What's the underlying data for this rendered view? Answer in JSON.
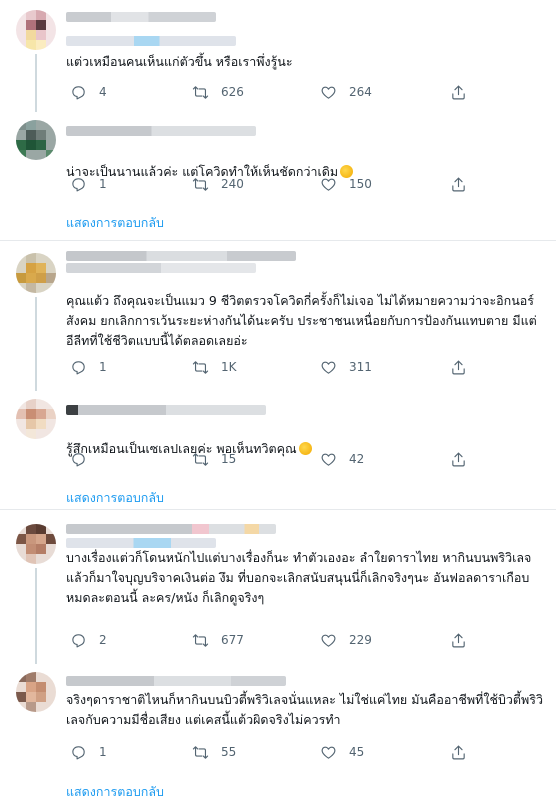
{
  "tweets": [
    {
      "text": "แต่วเหมือนคนเห็นแก่ตัวขึ้น หรือเราพึ่งรู้นะ",
      "replies": "4",
      "retweets": "626",
      "likes": "264"
    },
    {
      "text": "น่าจะเป็นนานแล้วค่ะ แต่โควิดทำให้เห็นชัดกว่าเดิม",
      "emoji": "sweat-smile-emoji",
      "replies": "1",
      "retweets": "240",
      "likes": "150",
      "show_replies": "แสดงการตอบกลับ"
    },
    {
      "text": "คุณแต้ว ถึงคุณจะเป็นแมว 9 ชีวิตตรวจโควิดกี่ครั้งก็ไม่เจอ ไม่ได้หมายความว่าจะอิกนอร์สังคม ยกเลิกการเว้นระยะห่างกันได้นะครับ ประชาชนเหนื่อยกับการป้องกันแทบตาย มีแต่อีลีทที่ใช้ชีวิตแบบนี้ได้ตลอดเลยอ่ะ",
      "replies": "1",
      "retweets": "1K",
      "likes": "311"
    },
    {
      "text": "รู้สึกเหมือนเป็นเซเลปเลยค่ะ พอเห็นทวิตคุณ",
      "emoji": "winking-tongue-emoji",
      "replies": "",
      "retweets": "15",
      "likes": "42",
      "show_replies": "แสดงการตอบกลับ"
    },
    {
      "text": "บางเรื่องแต่วก็โดนหนักไปแต่บางเรื่องก็นะ ทำตัวเองอะ ลำใยดาราไทย หากินบนพริวิเลจแล้วก็มาใจบุญบริจาคเงินต่อ งึม ที่บอกจะเลิกสนับสนุนนี่ก็เลิกจริงๆนะ อันฟอลดาราเกือบหมดละตอนนี้ ละคร/หนัง ก็เลิกดูจริงๆ",
      "replies": "2",
      "retweets": "677",
      "likes": "229"
    },
    {
      "text": "จริงๆดาราชาติไหนก็หากินบนบิวตี้พริวิเลจนั่นแหละ ไม่ใช่แค่ไทย มันคืออาชีพที่ใช้บิวตี้พริวิเลจกับความมีชื่อเสียง แต่เคสนี้แต้วผิดจริงไม่ควรทำ",
      "replies": "1",
      "retweets": "55",
      "likes": "45",
      "show_replies": "แสดงการตอบกลับ"
    }
  ],
  "icons": {
    "reply": "reply-icon",
    "retweet": "retweet-icon",
    "like": "like-icon",
    "share": "share-icon"
  },
  "colors": {
    "link": "#1d9bf0",
    "muted": "#536471",
    "text": "#0f1419",
    "divider": "#e6e9ec"
  }
}
